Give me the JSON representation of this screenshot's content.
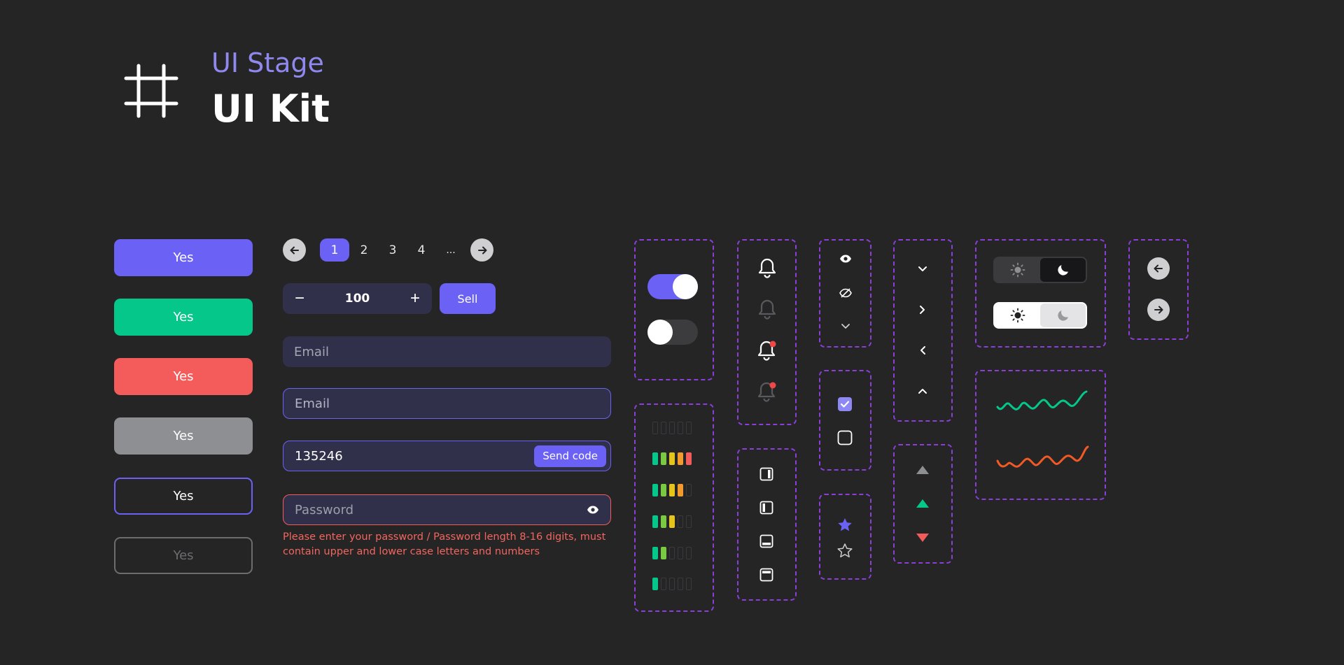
{
  "header": {
    "subtitle": "UI Stage",
    "title": "UI Kit",
    "logo_icon": "hash-frame-icon"
  },
  "buttons": [
    {
      "label": "Yes",
      "style": "primary"
    },
    {
      "label": "Yes",
      "style": "success"
    },
    {
      "label": "Yes",
      "style": "danger"
    },
    {
      "label": "Yes",
      "style": "disabled"
    },
    {
      "label": "Yes",
      "style": "outline"
    },
    {
      "label": "Yes",
      "style": "outline-disabled"
    }
  ],
  "pagination": {
    "pages": [
      "1",
      "2",
      "3",
      "4",
      "..."
    ],
    "current": "1"
  },
  "stepper": {
    "minus": "−",
    "value": "100",
    "plus": "+",
    "action_label": "Sell"
  },
  "inputs": {
    "email_placeholder": "Email",
    "email_focused_placeholder": "Email",
    "code_value": "135246",
    "send_code_label": "Send code",
    "password_placeholder": "Password",
    "password_error": "Please enter your password / Password length 8-16 digits, must contain upper and lower case letters and numbers"
  },
  "toggles": [
    {
      "state": "on"
    },
    {
      "state": "off"
    }
  ],
  "signal_levels": [
    0,
    5,
    4,
    3,
    2,
    1
  ],
  "colors": {
    "accent": "#6b62f5",
    "success": "#06c78a",
    "danger": "#f45c5c",
    "line_orange": "#f05a24",
    "panel_border": "#8a3fd9"
  },
  "icons": {
    "bells": [
      "bell-icon",
      "bell-muted-icon",
      "bell-badge-icon",
      "bell-badge-muted-icon"
    ],
    "layouts": [
      "panel-right-icon",
      "panel-left-icon",
      "panel-bottom-icon",
      "panel-top-icon"
    ],
    "visibility": [
      "eye-icon",
      "eye-off-icon",
      "chevron-down-icon"
    ],
    "chevrons": [
      "chevron-down-icon",
      "chevron-right-icon",
      "chevron-left-icon",
      "chevron-up-icon"
    ],
    "triangles": [
      "triangle-neutral-icon",
      "triangle-up-icon",
      "triangle-down-icon"
    ]
  },
  "checkboxes": [
    {
      "checked": true
    },
    {
      "checked": false
    }
  ],
  "stars": [
    {
      "filled": true
    },
    {
      "filled": false
    }
  ]
}
